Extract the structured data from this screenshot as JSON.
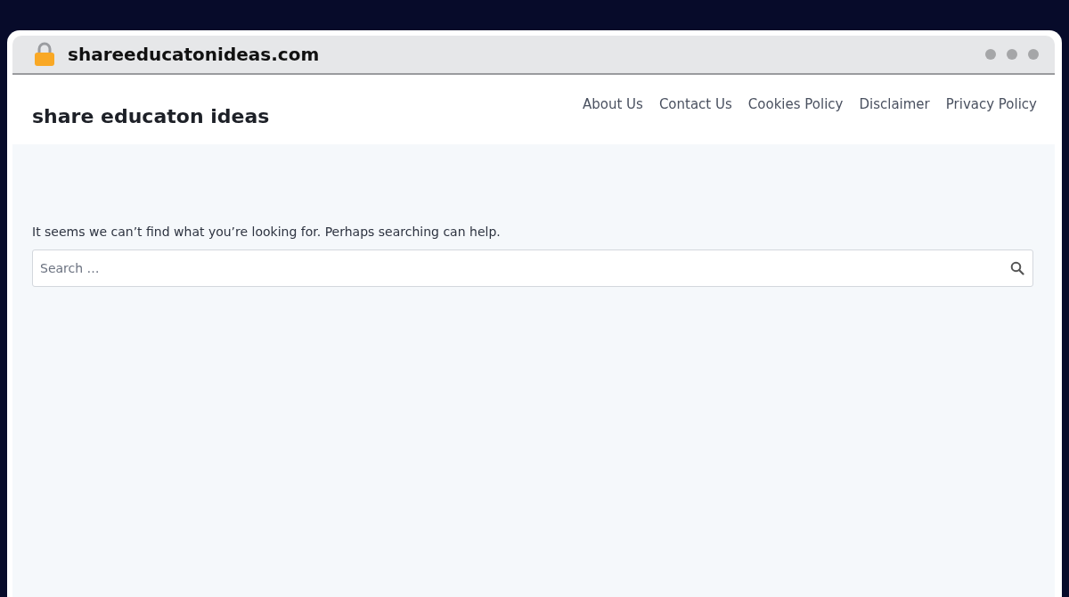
{
  "browser": {
    "address": "shareeducatonideas.com"
  },
  "site": {
    "title": "share educaton ideas",
    "nav": [
      {
        "label": "About Us"
      },
      {
        "label": "Contact Us"
      },
      {
        "label": "Cookies Policy"
      },
      {
        "label": "Disclaimer"
      },
      {
        "label": "Privacy Policy"
      }
    ]
  },
  "content": {
    "message": "It seems we can’t find what you’re looking for. Perhaps searching can help.",
    "search": {
      "placeholder": "Search …"
    }
  }
}
